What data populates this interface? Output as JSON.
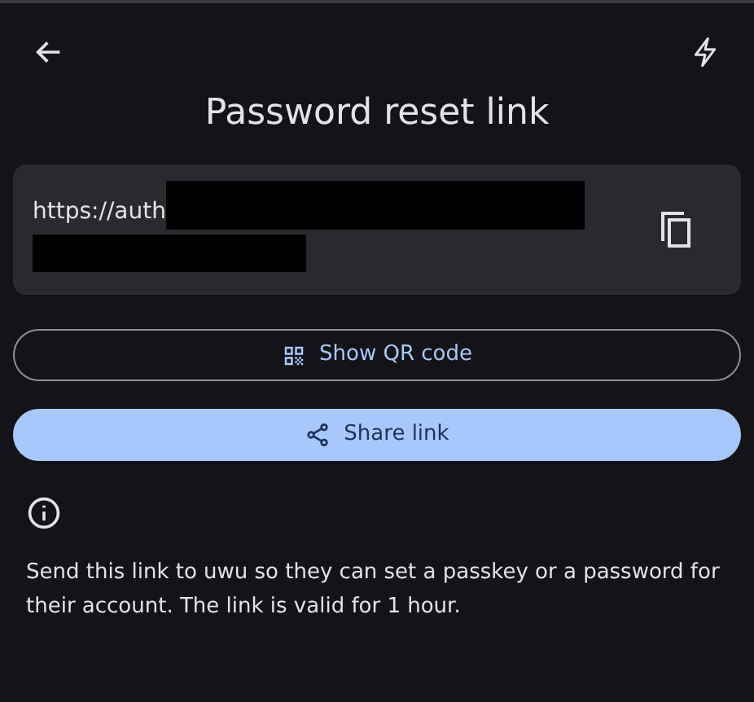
{
  "title": "Password reset link",
  "link": {
    "text": "https://auth",
    "redacted": true
  },
  "buttons": [
    {
      "label": "Show QR code",
      "kind": "outline"
    },
    {
      "label": "Share link",
      "kind": "filled"
    }
  ],
  "info": "Send this link to uwu so they can set a passkey or a password for their account. The link is valid for 1 hour."
}
